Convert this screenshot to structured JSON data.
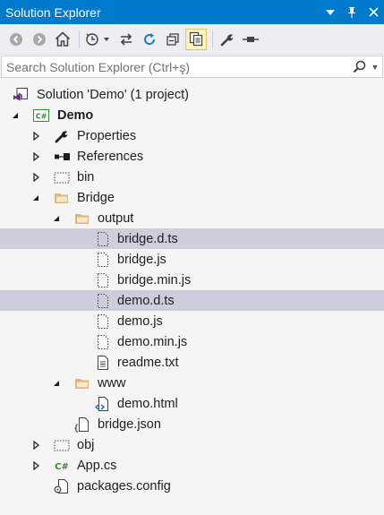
{
  "window": {
    "title": "Solution Explorer",
    "dropdown_icon": "chevron-down-icon",
    "pin_icon": "pin-icon",
    "close_icon": "close-icon"
  },
  "toolbar": {
    "buttons": [
      "back",
      "forward",
      "home",
      "pending-changes-filter",
      "sync-with-active-document",
      "refresh",
      "collapse-all",
      "show-all-files",
      "properties",
      "preview-selected-items"
    ]
  },
  "search": {
    "placeholder": "Search Solution Explorer (Ctrl+ş)"
  },
  "tree": {
    "solution": "Solution 'Demo' (1 project)",
    "project": "Demo",
    "properties": "Properties",
    "references": "References",
    "bin": "bin",
    "bridge": "Bridge",
    "output": "output",
    "bridge_d_ts": "bridge.d.ts",
    "bridge_js": "bridge.js",
    "bridge_min_js": "bridge.min.js",
    "demo_d_ts": "demo.d.ts",
    "demo_js": "demo.js",
    "demo_min_js": "demo.min.js",
    "readme_txt": "readme.txt",
    "www": "www",
    "demo_html": "demo.html",
    "bridge_json": "bridge.json",
    "obj": "obj",
    "app_cs": "App.cs",
    "packages_config": "packages.config"
  },
  "colors": {
    "title_bg": "#007acc",
    "selection": "#cccedb",
    "folder": "#dcb67a",
    "csharp": "#388a34"
  }
}
